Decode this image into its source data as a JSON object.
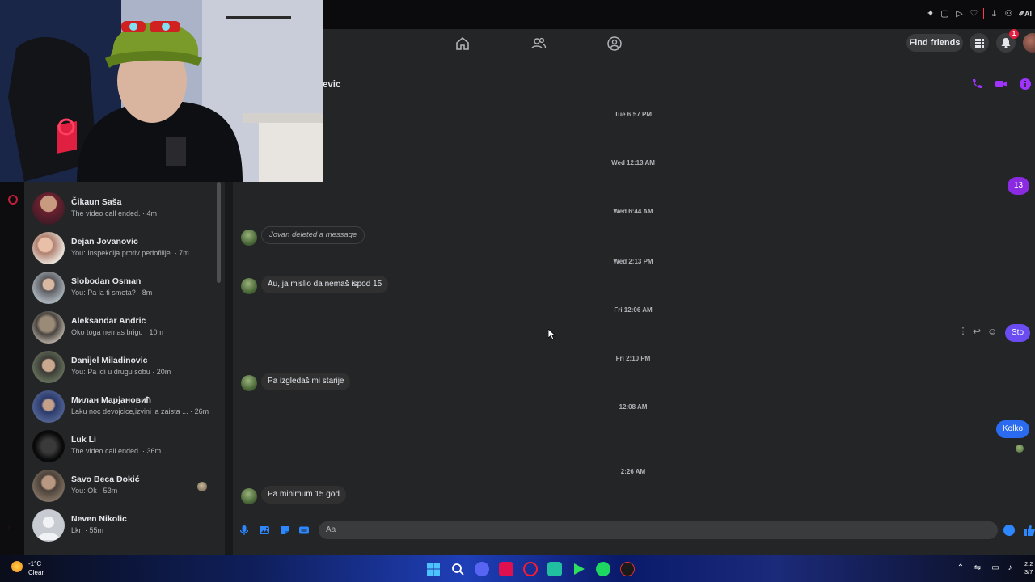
{
  "navbar": {
    "find_friends_label": "Find friends",
    "notification_count": "1"
  },
  "conversation": {
    "contact_name_partial": "evic",
    "composer_placeholder": "Aa",
    "messages": [
      {
        "type": "timestamp",
        "text": "Tue 6:57 PM"
      },
      {
        "type": "timestamp",
        "text": "Wed 12:13 AM"
      },
      {
        "type": "outgoing",
        "text": "13"
      },
      {
        "type": "timestamp",
        "text": "Wed 6:44 AM"
      },
      {
        "type": "deleted",
        "text": "Jovan deleted a message"
      },
      {
        "type": "timestamp",
        "text": "Wed 2:13 PM"
      },
      {
        "type": "incoming",
        "text": "Au, ja mislio da nemaš ispod 15"
      },
      {
        "type": "timestamp",
        "text": "Fri 12:06 AM"
      },
      {
        "type": "outgoing",
        "text": "Sto"
      },
      {
        "type": "timestamp",
        "text": "Fri 2:10 PM"
      },
      {
        "type": "incoming",
        "text": "Pa izgledaš mi starije"
      },
      {
        "type": "timestamp",
        "text": "12:08 AM"
      },
      {
        "type": "outgoing",
        "text": "Kolko"
      },
      {
        "type": "timestamp",
        "text": "2:26 AM"
      },
      {
        "type": "incoming",
        "text": "Pa minimum 15 god"
      }
    ]
  },
  "chat_list": [
    {
      "name": "Čikaun Saša",
      "preview": "The video call ended. · 4m"
    },
    {
      "name": "Dejan Jovanovic",
      "preview": "You: Inspekcija protiv pedofilije. · 7m"
    },
    {
      "name": "Slobodan Osman",
      "preview": "You: Pa la ti smeta? · 8m"
    },
    {
      "name": "Aleksandar Andric",
      "preview": "Oko toga nemas brigu · 10m"
    },
    {
      "name": "Danijel Miladinovic",
      "preview": "You: Pa idi u drugu sobu · 20m"
    },
    {
      "name": "Милан Марјановић",
      "preview": "Laku noc devojcice,izvini ja zaista ... · 26m"
    },
    {
      "name": "Luk Li",
      "preview": "The video call ended. · 36m"
    },
    {
      "name": "Savo Beca Đokić",
      "preview": "You: Ok · 53m"
    },
    {
      "name": "Neven Nikolic",
      "preview": "Lkn · 55m"
    }
  ],
  "taskbar": {
    "temperature": "-1°C",
    "weather": "Clear",
    "clock_time": "2:2",
    "clock_date": "3/7"
  },
  "colors": {
    "accent_purple": "#8a2be2",
    "messenger_blue": "#2b6bf0",
    "panel": "#242526",
    "background": "#18191a"
  }
}
